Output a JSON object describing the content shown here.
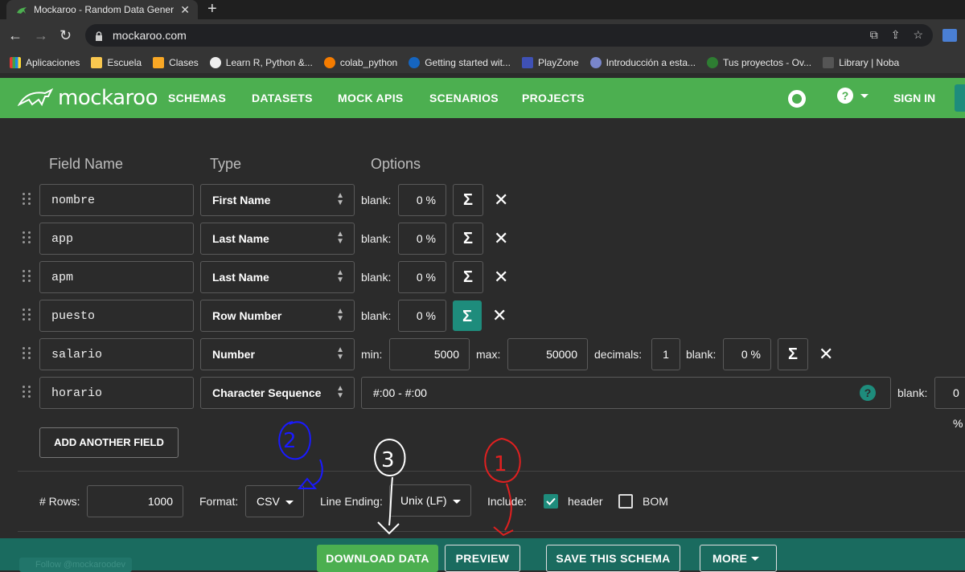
{
  "browser": {
    "tab_title": "Mockaroo - Random Data Gener",
    "url": "mockaroo.com",
    "bookmarks": [
      "Aplicaciones",
      "Escuela",
      "Clases",
      "Learn R, Python &...",
      "colab_python",
      "Getting started wit...",
      "PlayZone",
      "Introducción a esta...",
      "Tus proyectos - Ov...",
      "Library | Noba"
    ]
  },
  "header": {
    "logo": "mockaroo",
    "nav": [
      "SCHEMAS",
      "DATASETS",
      "MOCK APIS",
      "SCENARIOS",
      "PROJECTS"
    ],
    "signin": "SIGN IN",
    "help": "?"
  },
  "columns": {
    "field_name": "Field Name",
    "type": "Type",
    "options": "Options"
  },
  "fields": [
    {
      "name": "nombre",
      "type": "First Name",
      "blank": "0 %"
    },
    {
      "name": "app",
      "type": "Last Name",
      "blank": "0 %"
    },
    {
      "name": "apm",
      "type": "Last Name",
      "blank": "0 %"
    },
    {
      "name": "puesto",
      "type": "Row Number",
      "blank": "0 %"
    },
    {
      "name": "salario",
      "type": "Number",
      "min": "5000",
      "max": "50000",
      "decimals": "1",
      "blank": "0 %"
    },
    {
      "name": "horario",
      "type": "Character Sequence",
      "format": "#:00 - #:00",
      "blank": "0 %"
    }
  ],
  "labels": {
    "blank": "blank:",
    "min": "min:",
    "max": "max:",
    "decimals": "decimals:",
    "sigma": "Σ",
    "remove": "✕",
    "qmark": "?"
  },
  "add_field": "ADD ANOTHER FIELD",
  "settings": {
    "rows_label": "# Rows:",
    "rows": "1000",
    "format_label": "Format:",
    "format": "CSV",
    "line_ending_label": "Line Ending:",
    "line_ending": "Unix (LF)",
    "include_label": "Include:",
    "header_label": "header",
    "header_checked": true,
    "bom_label": "BOM",
    "bom_checked": false
  },
  "actions": {
    "download": "DOWNLOAD DATA",
    "preview": "PREVIEW",
    "save": "SAVE THIS SCHEMA",
    "more": "MORE"
  },
  "annotations": {
    "one": "1",
    "two": "2",
    "three": "3"
  },
  "colors": {
    "brand_green": "#4caf50",
    "teal": "#1e8c7c",
    "bottom_bar": "#1a6b5f",
    "bg": "#2b2b2b"
  }
}
